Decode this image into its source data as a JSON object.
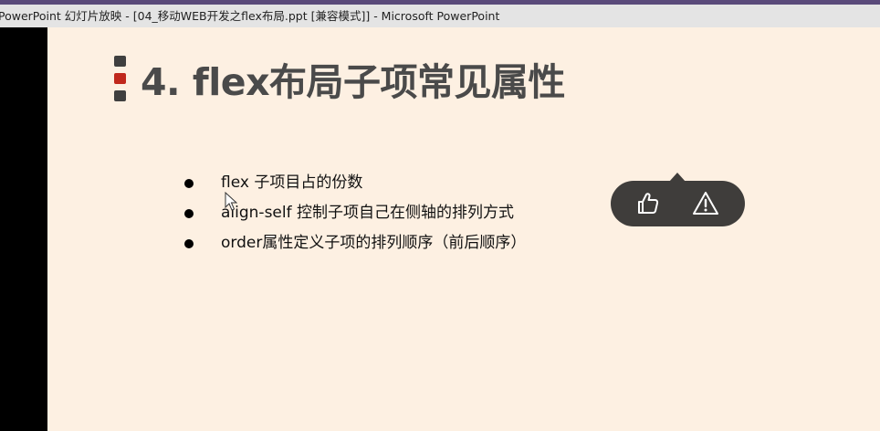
{
  "window": {
    "title": "PowerPoint 幻灯片放映 - [04_移动WEB开发之flex布局.ppt [兼容模式]] - Microsoft PowerPoint"
  },
  "slide": {
    "title": "4. flex布局子项常见属性",
    "marker_colors": [
      "#3f3f3f",
      "#c0281c",
      "#3f3f3f"
    ],
    "bullets": [
      "flex 子项目占的份数",
      "align-self 控制子项自己在侧轴的排列方式",
      "order属性定义子项的排列顺序（前后顺序）"
    ]
  },
  "feedback": {
    "like_icon": "thumbs-up-icon",
    "report_icon": "warning-icon"
  },
  "colors": {
    "slide_background": "#fdf0e2",
    "title_text": "#4a4a4a",
    "popup_background": "#3f3d3b",
    "accent_red": "#c0281c"
  }
}
